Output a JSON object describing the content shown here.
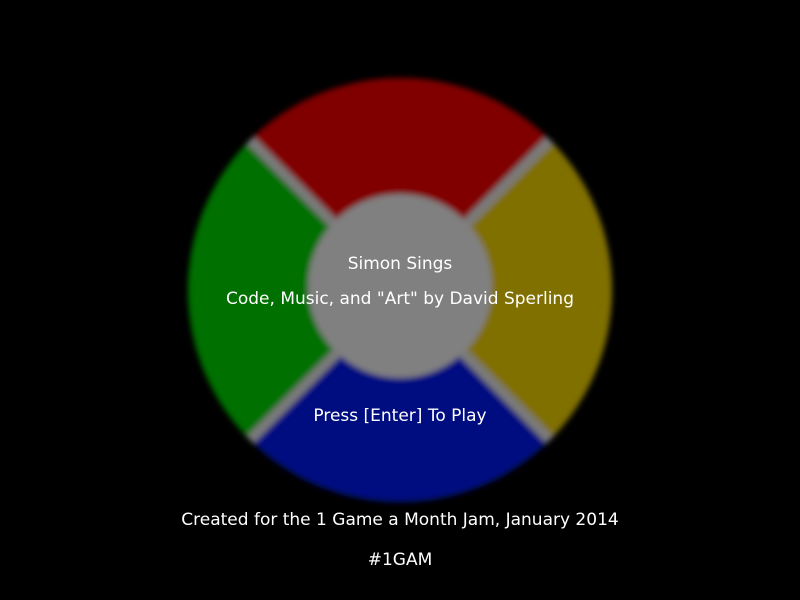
{
  "game": {
    "title": "Simon Sings",
    "credits": "Code, Music, and \"Art\" by David Sperling",
    "prompt": "Press [Enter] To Play",
    "footer": "Created for the 1 Game a Month Jam, January 2014",
    "tag": "#1GAM"
  },
  "colors": {
    "background": "#000000",
    "top_pad": "#800000",
    "right_pad": "#807000",
    "bottom_pad": "#000f80",
    "left_pad": "#007000",
    "center": "#808080",
    "text": "#ffffff"
  }
}
